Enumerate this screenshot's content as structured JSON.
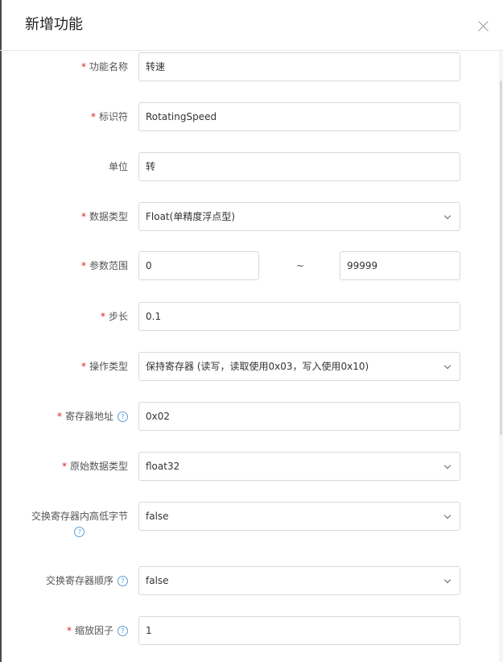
{
  "dialog": {
    "title": "新增功能"
  },
  "form": {
    "function_name": {
      "label": "功能名称",
      "value": "转速",
      "required": true
    },
    "identifier": {
      "label": "标识符",
      "value": "RotatingSpeed",
      "required": true
    },
    "unit": {
      "label": "单位",
      "value": "转",
      "required": false
    },
    "data_type": {
      "label": "数据类型",
      "value": "Float(单精度浮点型)",
      "required": true
    },
    "param_range": {
      "label": "参数范围",
      "min": "0",
      "separator": "~",
      "max": "99999",
      "required": true
    },
    "step": {
      "label": "步长",
      "value": "0.1",
      "required": true
    },
    "operation_type": {
      "label": "操作类型",
      "value": "保持寄存器 (读写，读取使用0x03，写入使用0x10)",
      "required": true
    },
    "register_address": {
      "label": "寄存器地址",
      "value": "0x02",
      "required": true
    },
    "raw_data_type": {
      "label": "原始数据类型",
      "value": "float32",
      "required": true
    },
    "swap_bytes": {
      "label": "交换寄存器内高低字节",
      "value": "false",
      "required": false
    },
    "swap_order": {
      "label": "交换寄存器顺序",
      "value": "false",
      "required": false
    },
    "scale_factor": {
      "label": "缩放因子",
      "value": "1",
      "required": true
    }
  },
  "icons": {
    "help": "help-circle-icon",
    "close": "close-icon",
    "dropdown": "chevron-down-icon"
  },
  "colors": {
    "required": "#e02020",
    "help": "#5b9bd5",
    "border": "#d9d9d9"
  }
}
